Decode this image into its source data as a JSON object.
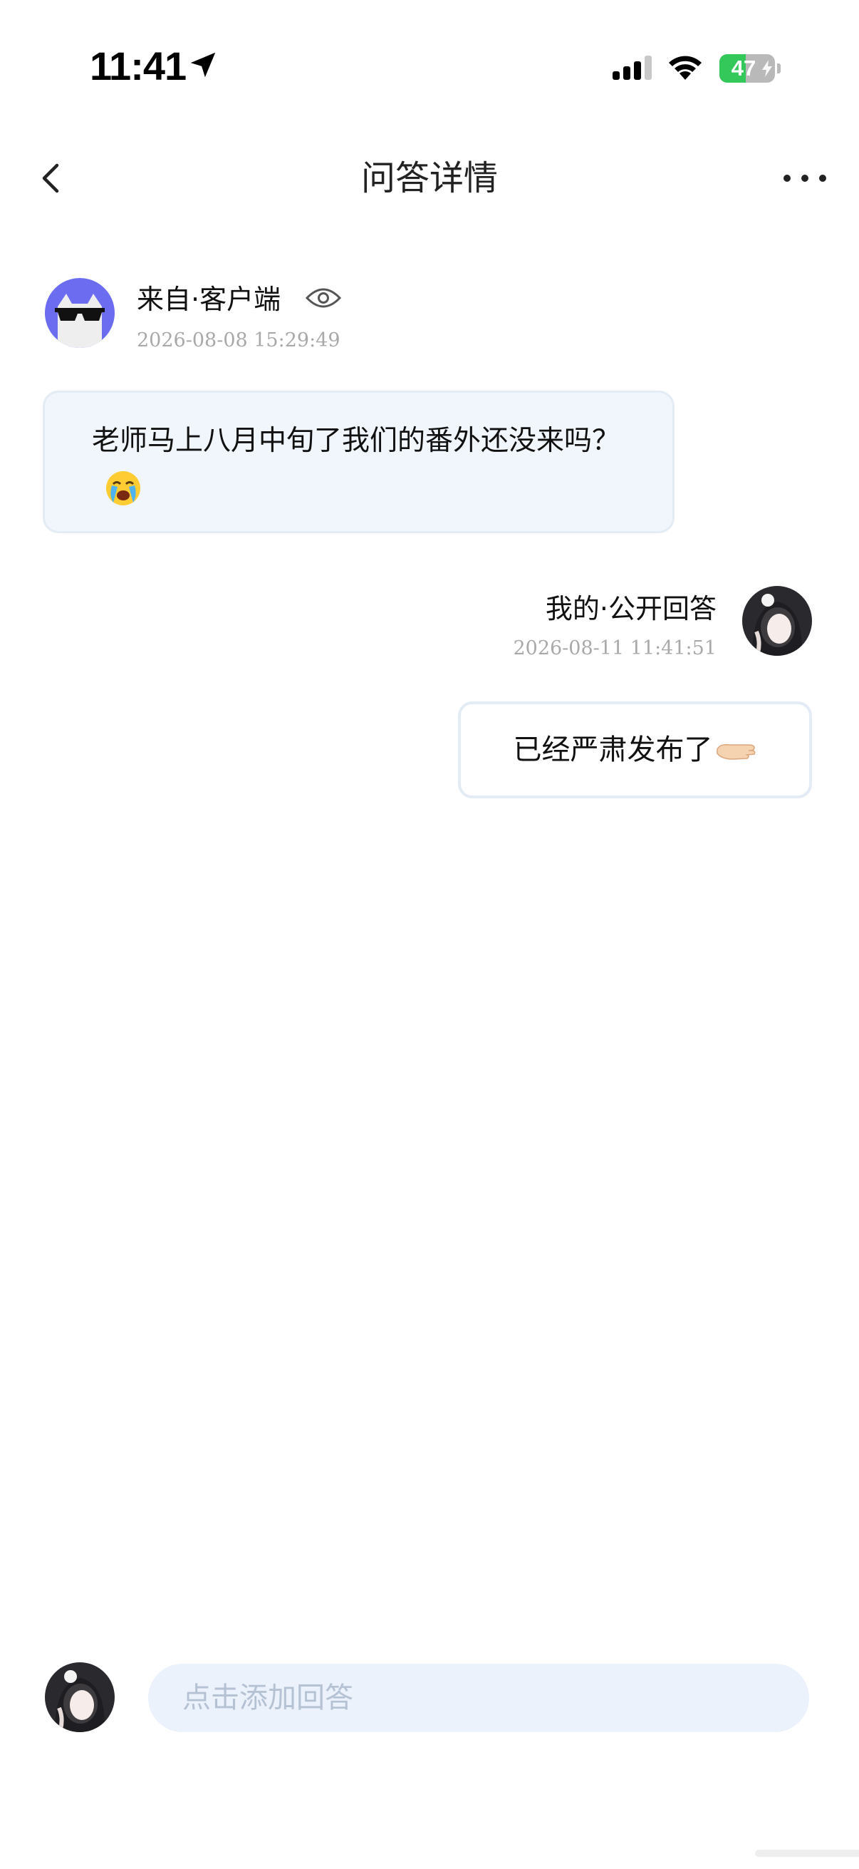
{
  "status_bar": {
    "time": "11:41",
    "battery_percent": "47",
    "battery_level": 0.47,
    "icons": [
      "location-arrow-icon",
      "cellular-signal-icon",
      "wifi-icon",
      "battery-charging-icon"
    ]
  },
  "nav": {
    "title": "问答详情",
    "back_icon": "chevron-left-icon",
    "more_icon": "more-horizontal-icon"
  },
  "question": {
    "author": "来自·客户端",
    "time": "2026-08-08 15:29:49",
    "text": "老师马上八月中旬了我们的番外还没来吗？",
    "emoji": "loudly-crying-face"
  },
  "answer": {
    "author": "我的·公开回答",
    "time": "2026-08-11 11:41:51",
    "text": "已经严肃发布了",
    "emoji": "palm-down-hand"
  },
  "composer": {
    "placeholder": "点击添加回答"
  },
  "colors": {
    "accent_avatar": "#6b6cf0",
    "question_bubble": "#f1f6fc",
    "input_bg": "#ecf2fb",
    "timestamp": "#a9a9a9",
    "battery_green": "#34c759"
  }
}
